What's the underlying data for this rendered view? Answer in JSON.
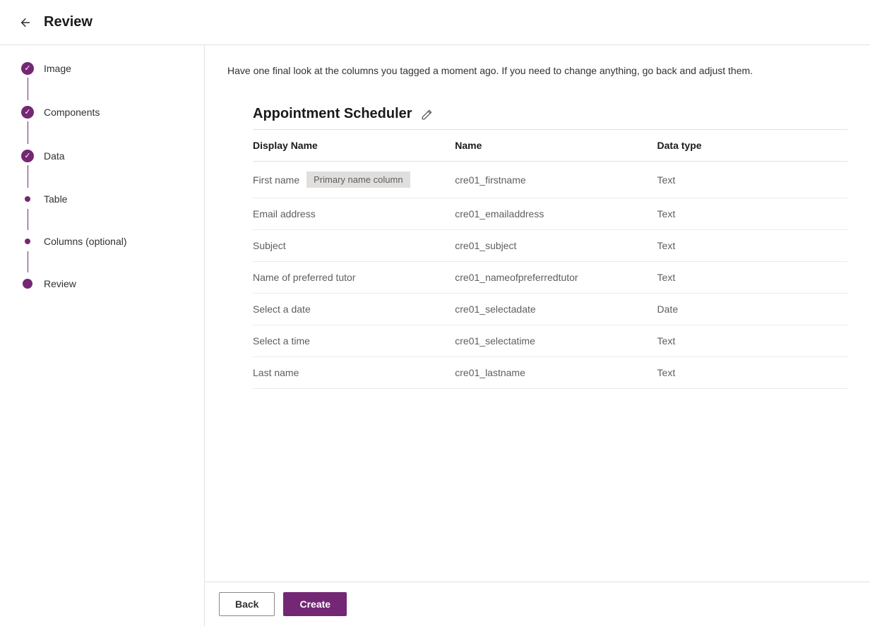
{
  "header": {
    "title": "Review"
  },
  "steps": [
    {
      "label": "Image",
      "kind": "check"
    },
    {
      "label": "Components",
      "kind": "check"
    },
    {
      "label": "Data",
      "kind": "check"
    },
    {
      "label": "Table",
      "kind": "small"
    },
    {
      "label": "Columns (optional)",
      "kind": "small"
    },
    {
      "label": "Review",
      "kind": "big"
    }
  ],
  "description": "Have one final look at the columns you tagged a moment ago. If you need to change anything, go back and adjust them.",
  "appTitle": "Appointment Scheduler",
  "tableHeaders": {
    "displayName": "Display Name",
    "name": "Name",
    "dataType": "Data type"
  },
  "badge": "Primary name column",
  "rows": [
    {
      "displayName": "First name",
      "badge": true,
      "name": "cre01_firstname",
      "dataType": "Text"
    },
    {
      "displayName": "Email address",
      "badge": false,
      "name": "cre01_emailaddress",
      "dataType": "Text"
    },
    {
      "displayName": "Subject",
      "badge": false,
      "name": "cre01_subject",
      "dataType": "Text"
    },
    {
      "displayName": "Name of preferred tutor",
      "badge": false,
      "name": "cre01_nameofpreferredtutor",
      "dataType": "Text"
    },
    {
      "displayName": "Select a date",
      "badge": false,
      "name": "cre01_selectadate",
      "dataType": "Date"
    },
    {
      "displayName": "Select a time",
      "badge": false,
      "name": "cre01_selectatime",
      "dataType": "Text"
    },
    {
      "displayName": "Last name",
      "badge": false,
      "name": "cre01_lastname",
      "dataType": "Text"
    }
  ],
  "footer": {
    "back": "Back",
    "create": "Create"
  }
}
